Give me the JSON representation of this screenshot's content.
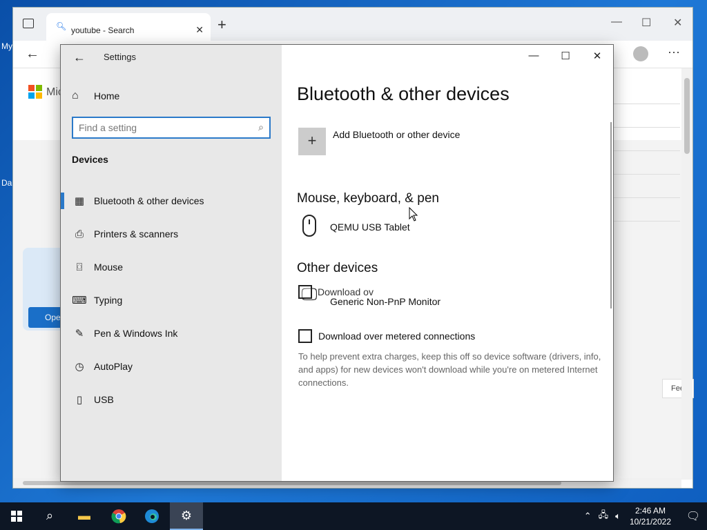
{
  "desktop": {
    "icon_labels": [
      "My",
      "Da"
    ]
  },
  "browser": {
    "tab_title": "youtube - Search",
    "tab_favicon": "search-icon",
    "page_brand": "Mic",
    "promo_button": "Ope",
    "fee_tag": "Fee",
    "brand_colors": {
      "red": "#f25022",
      "green": "#7fba00",
      "blue": "#00a4ef",
      "yellow": "#ffb900"
    }
  },
  "settings": {
    "window_title": "Settings",
    "home_label": "Home",
    "search_placeholder": "Find a setting",
    "section_title": "Devices",
    "nav_items": [
      {
        "label": "Bluetooth & other devices",
        "icon": "bluetooth-devices-icon",
        "active": true
      },
      {
        "label": "Printers & scanners",
        "icon": "printer-icon",
        "active": false
      },
      {
        "label": "Mouse",
        "icon": "mouse-icon",
        "active": false
      },
      {
        "label": "Typing",
        "icon": "keyboard-icon",
        "active": false
      },
      {
        "label": "Pen & Windows Ink",
        "icon": "pen-icon",
        "active": false
      },
      {
        "label": "AutoPlay",
        "icon": "autoplay-icon",
        "active": false
      },
      {
        "label": "USB",
        "icon": "usb-icon",
        "active": false
      }
    ],
    "page_title": "Bluetooth & other devices",
    "add_device_label": "Add Bluetooth or other device",
    "mouse_section_title": "Mouse, keyboard, & pen",
    "mouse_device": "QEMU USB Tablet",
    "other_section_title": "Other devices",
    "monitor_device": "Generic Non-PnP Monitor",
    "overlap_text": "Download ov",
    "metered_label": "Download over metered connections",
    "metered_checked": false,
    "help_text": "To help prevent extra charges, keep this off so device software (drivers, info, and apps) for new devices won't download while you're on metered Internet connections.",
    "accent_color": "#2a79c9"
  },
  "taskbar": {
    "time": "2:46 AM",
    "date": "10/21/2022",
    "apps": [
      "start",
      "search",
      "file-explorer",
      "chrome",
      "edge",
      "settings"
    ]
  }
}
